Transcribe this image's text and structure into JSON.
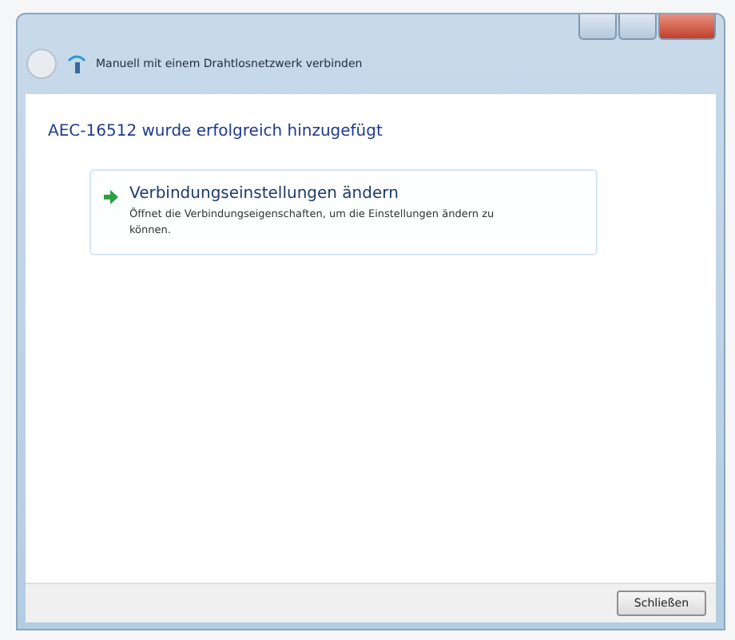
{
  "window": {
    "title": "Manuell mit einem Drahtlosnetzwerk verbinden"
  },
  "heading": "AEC-16512 wurde erfolgreich hinzugefügt",
  "options": [
    {
      "title": "Verbindungseinstellungen ändern",
      "description": "Öffnet die Verbindungseigenschaften, um die Einstellungen ändern zu können."
    }
  ],
  "buttons": [
    "Schließen"
  ]
}
